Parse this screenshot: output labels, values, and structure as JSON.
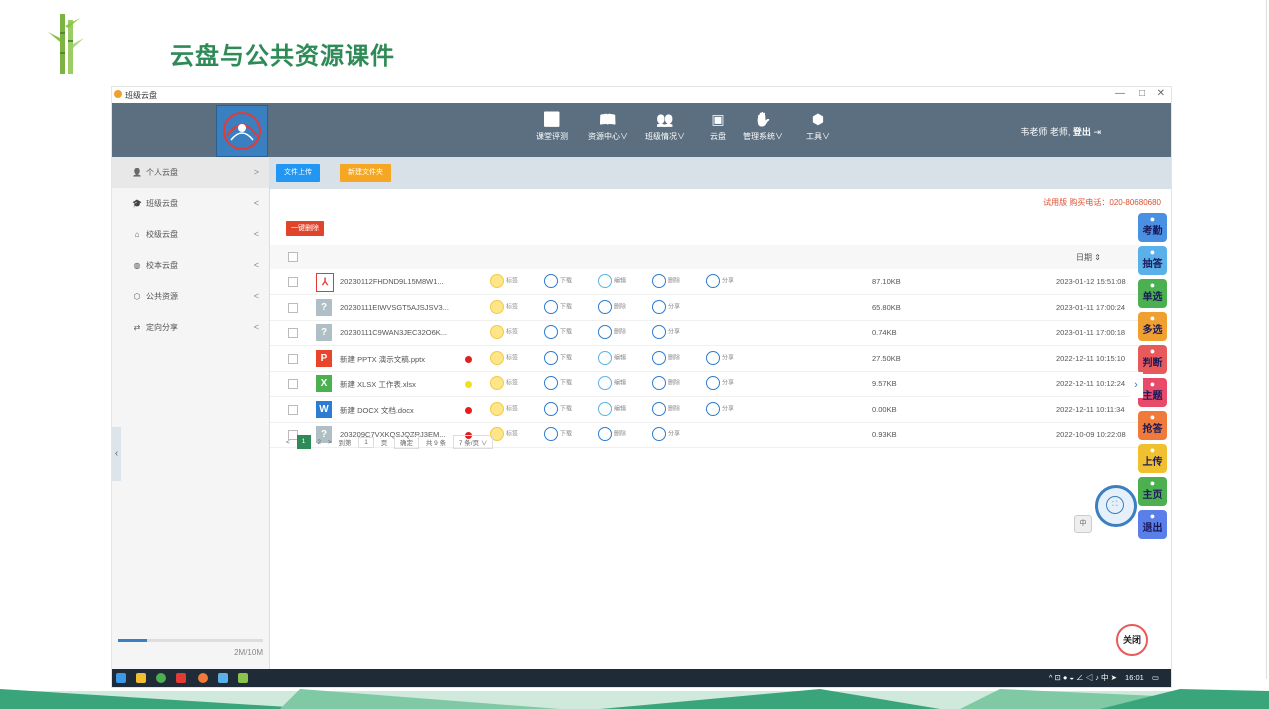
{
  "slide": {
    "title": "云盘与公共资源课件",
    "bamboo_icon": "bamboo-icon"
  },
  "window": {
    "title": "班级云盘",
    "min": "—",
    "max": "□",
    "close": "✕"
  },
  "nav": {
    "items": [
      {
        "label": "课堂评测",
        "icon": "clipboard-check-icon"
      },
      {
        "label": "资源中心∨",
        "icon": "book-icon"
      },
      {
        "label": "班级情况∨",
        "icon": "people-icon"
      },
      {
        "label": "云盘",
        "icon": "tablet-icon"
      },
      {
        "label": "管理系统∨",
        "icon": "settings-hand-icon"
      },
      {
        "label": "工具∨",
        "icon": "cube-icon"
      }
    ],
    "user": "韦老师 老师,",
    "logout": "登出"
  },
  "sidebar": {
    "items": [
      {
        "label": "个人云盘",
        "icon": "person-icon",
        "arrow": ">",
        "active": true
      },
      {
        "label": "班级云盘",
        "icon": "graduation-cap-icon",
        "arrow": "<"
      },
      {
        "label": "校级云盘",
        "icon": "house-icon",
        "arrow": "<"
      },
      {
        "label": "校本云盘",
        "icon": "globe-icon",
        "arrow": "<"
      },
      {
        "label": "公共资源",
        "icon": "box-icon",
        "arrow": "<"
      },
      {
        "label": "定向分享",
        "icon": "link-icon",
        "arrow": "<"
      }
    ],
    "collapse": "‹",
    "storage": {
      "used_fraction": 0.2,
      "text": "2M/10M"
    }
  },
  "toolbar": {
    "upload": "文件上传",
    "new_folder": "新建文件夹",
    "trial": "试用版 购买电话：020-80680680",
    "delete_all": "一键删除",
    "date_header": "日期 ⇕"
  },
  "actions": {
    "tag": "标签",
    "download": "下载",
    "edit": "编辑",
    "delete": "删除",
    "share": "分享"
  },
  "files": [
    {
      "name": "20230112FHDND9L15M8W1...",
      "type": "pdf",
      "dot": "",
      "editable": true,
      "size": "87.10KB",
      "date": "2023-01-12 15:51:08"
    },
    {
      "name": "20230111EIWVSGT5AJSJSV3...",
      "type": "unknown",
      "dot": "",
      "editable": false,
      "size": "65.80KB",
      "date": "2023-01-11 17:00:24"
    },
    {
      "name": "20230111C9WAN3JEC32O6K...",
      "type": "unknown",
      "dot": "",
      "editable": false,
      "size": "0.74KB",
      "date": "2023-01-11 17:00:18"
    },
    {
      "name": "新建 PPTX 演示文稿.pptx",
      "type": "pptx",
      "dot": "#e02020",
      "editable": true,
      "size": "27.50KB",
      "date": "2022-12-11 10:15:10"
    },
    {
      "name": "新建 XLSX 工作表.xlsx",
      "type": "xlsx",
      "dot": "#f0e020",
      "editable": true,
      "size": "9.57KB",
      "date": "2022-12-11 10:12:24"
    },
    {
      "name": "新建 DOCX 文档.docx",
      "type": "docx",
      "dot": "#e02020",
      "editable": true,
      "size": "0.00KB",
      "date": "2022-12-11 10:11:34"
    },
    {
      "name": "203209C7VXKQSJQZRJ3EM...",
      "type": "unknown",
      "dot": "#e02020",
      "editable": false,
      "size": "0.93KB",
      "date": "2022-10-09 10:22:08"
    }
  ],
  "pager": {
    "prev": "<",
    "page1": "1",
    "page2": "2",
    "next": ">",
    "goto": "到第",
    "goto_val": "1",
    "page_unit": "页",
    "confirm": "确定",
    "total": "共 9 条",
    "per_page": "7 条/页 ∨"
  },
  "right_tools": [
    {
      "label": "考勤",
      "icon": "clock-icon",
      "color": "#4a90e2"
    },
    {
      "label": "抽答",
      "icon": "shuffle-icon",
      "color": "#5ab0e8"
    },
    {
      "label": "单选",
      "icon": "check-icon",
      "color": "#4caf50"
    },
    {
      "label": "多选",
      "icon": "double-check-icon",
      "color": "#f0a030"
    },
    {
      "label": "判断",
      "icon": "judge-icon",
      "color": "#e85a5a"
    },
    {
      "label": "主题",
      "icon": "theme-icon",
      "color": "#e84a6a"
    },
    {
      "label": "抢答",
      "icon": "hand-icon",
      "color": "#f07a3a"
    },
    {
      "label": "上传",
      "icon": "upload-icon",
      "color": "#f0c030"
    },
    {
      "label": "主页",
      "icon": "home-icon",
      "color": "#4caf50"
    },
    {
      "label": "退出",
      "icon": "exit-icon",
      "color": "#5a7fe8"
    }
  ],
  "right_expand": "›",
  "close_label": "关闭",
  "taskbar": {
    "tray": "^ ⊡ ● ◒ ∠ ◁ ♪ 中 ➤",
    "time": "16:01"
  }
}
